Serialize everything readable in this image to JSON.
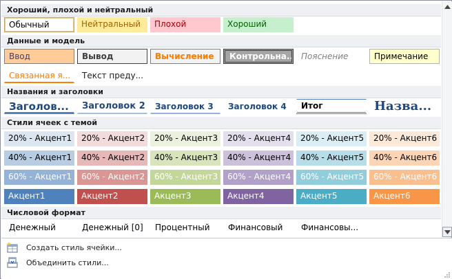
{
  "sections": {
    "good_bad_neutral": "Хороший, плохой и нейтральный",
    "data_model": "Данные и модель",
    "titles": "Названия и заголовки",
    "theme_styles": "Стили ячеек с темой",
    "number_format": "Числовой формат"
  },
  "good_bad_neutral": {
    "normal": "Обычный",
    "neutral": "Нейтральный",
    "bad": "Плохой",
    "good": "Хороший"
  },
  "data_model": {
    "input": "Ввод",
    "output": "Вывод",
    "calculation": "Вычисление",
    "check_cell": "Контрольна...",
    "explanatory": "Пояснение",
    "note": "Примечание",
    "linked_cell": "Связанная я...",
    "warning_text": "Текст преду..."
  },
  "titles": {
    "heading1": "Заголов...",
    "heading2": "Заголовок 2",
    "heading3": "Заголовок 3",
    "heading4": "Заголовок 4",
    "total": "Итог",
    "title": "Назва..."
  },
  "theme_styles": {
    "row20": [
      "20% - Акцент1",
      "20% - Акцент2",
      "20% - Акцент3",
      "20% - Акцент4",
      "20% - Акцент5",
      "20% - Акцент6"
    ],
    "row40": [
      "40% - Акцент1",
      "40% - Акцент2",
      "40% - Акцент3",
      "40% - Акцент4",
      "40% - Акцент5",
      "40% - Акцент6"
    ],
    "row60": [
      "60% - Акцент1",
      "60% - Акцент2",
      "60% - Акцент3",
      "60% - Акцент4",
      "60% - Акцент5",
      "60% - Акцент6"
    ],
    "row100": [
      "Акцент1",
      "Акцент2",
      "Акцент3",
      "Акцент4",
      "Акцент5",
      "Акцент6"
    ]
  },
  "number_format": {
    "currency": "Денежный",
    "currency0": "Денежный [0]",
    "percent": "Процентный",
    "financial": "Финансовый",
    "financial0": "Финансовы..."
  },
  "menu": {
    "new_style": "Создать стиль ячейки...",
    "merge_styles": "Объединить стили..."
  },
  "icons": {
    "scroll_up": "scroll-up-icon",
    "scroll_down": "scroll-down-icon",
    "new_style": "new-cell-style-icon",
    "merge": "merge-styles-icon",
    "grip": "resize-grip-icon"
  },
  "colors": {
    "accent1": "#4f81bd",
    "accent2": "#c0504d",
    "accent3": "#9bbb59",
    "accent4": "#8064a2",
    "accent5": "#4bacc6",
    "accent6": "#f79646"
  }
}
